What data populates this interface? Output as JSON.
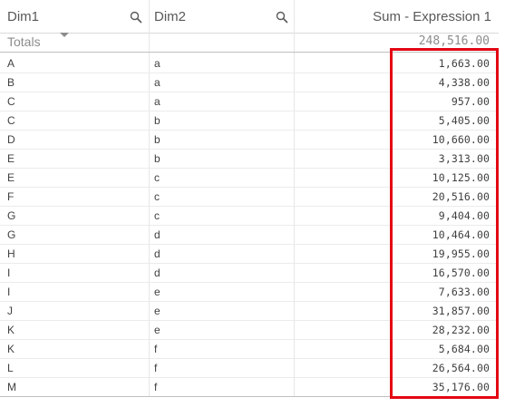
{
  "table": {
    "headers": {
      "dim1": "Dim1",
      "dim2": "Dim2",
      "measure": "Sum - Expression 1"
    },
    "totals": {
      "label": "Totals",
      "value": "248,516.00"
    },
    "rows": [
      {
        "dim1": "A",
        "dim2": "a",
        "value": "1,663.00"
      },
      {
        "dim1": "B",
        "dim2": "a",
        "value": "4,338.00"
      },
      {
        "dim1": "C",
        "dim2": "a",
        "value": "957.00"
      },
      {
        "dim1": "C",
        "dim2": "b",
        "value": "5,405.00"
      },
      {
        "dim1": "D",
        "dim2": "b",
        "value": "10,660.00"
      },
      {
        "dim1": "E",
        "dim2": "b",
        "value": "3,313.00"
      },
      {
        "dim1": "E",
        "dim2": "c",
        "value": "10,125.00"
      },
      {
        "dim1": "F",
        "dim2": "c",
        "value": "20,516.00"
      },
      {
        "dim1": "G",
        "dim2": "c",
        "value": "9,404.00"
      },
      {
        "dim1": "G",
        "dim2": "d",
        "value": "10,464.00"
      },
      {
        "dim1": "H",
        "dim2": "d",
        "value": "19,955.00"
      },
      {
        "dim1": "I",
        "dim2": "d",
        "value": "16,570.00"
      },
      {
        "dim1": "I",
        "dim2": "e",
        "value": "7,633.00"
      },
      {
        "dim1": "J",
        "dim2": "e",
        "value": "31,857.00"
      },
      {
        "dim1": "K",
        "dim2": "e",
        "value": "28,232.00"
      },
      {
        "dim1": "K",
        "dim2": "f",
        "value": "5,684.00"
      },
      {
        "dim1": "L",
        "dim2": "f",
        "value": "26,564.00"
      },
      {
        "dim1": "M",
        "dim2": "f",
        "value": "35,176.00"
      }
    ]
  },
  "icons": {
    "dim1_search": "search-icon",
    "dim2_search": "search-icon",
    "sort": "sort-descending-icon"
  },
  "colors": {
    "highlight": "#e30613"
  }
}
